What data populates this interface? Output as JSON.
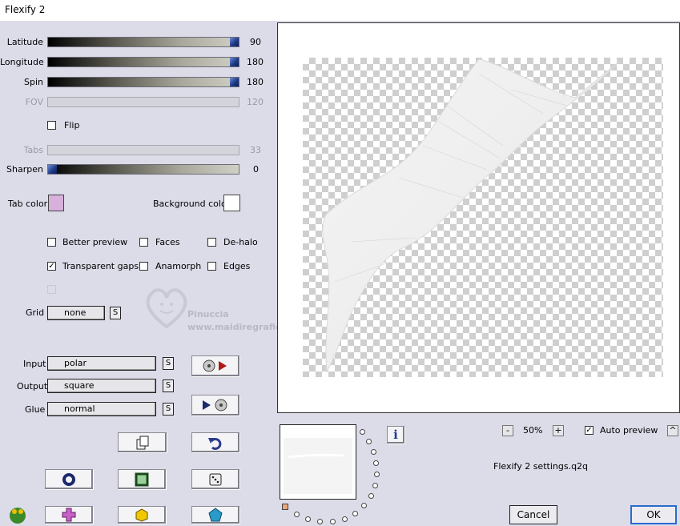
{
  "window": {
    "title": "Flexify 2"
  },
  "sliders": [
    {
      "label": "Latitude",
      "value": "90",
      "enabled": true,
      "level": 1.0
    },
    {
      "label": "Longitude",
      "value": "180",
      "enabled": true,
      "level": 1.0
    },
    {
      "label": "Spin",
      "value": "180",
      "enabled": true,
      "level": 1.0
    },
    {
      "label": "FOV",
      "value": "120",
      "enabled": false
    },
    {
      "label": "Tabs",
      "value": "33",
      "enabled": false
    },
    {
      "label": "Sharpen",
      "value": "0",
      "enabled": true,
      "level": 0.0
    }
  ],
  "flip": {
    "label": "Flip",
    "checked": false
  },
  "tab_color": {
    "label": "Tab color",
    "color": "#d8b0dc"
  },
  "background_color": {
    "label": "Background color",
    "color": "#ffffff"
  },
  "options": {
    "better_preview": {
      "label": "Better preview",
      "checked": false
    },
    "faces": {
      "label": "Faces",
      "checked": false
    },
    "de_halo": {
      "label": "De-halo",
      "checked": false
    },
    "transparent_gaps": {
      "label": "Transparent gaps",
      "checked": true
    },
    "anamorph": {
      "label": "Anamorph",
      "checked": false
    },
    "edges": {
      "label": "Edges",
      "checked": false
    }
  },
  "grid": {
    "label": "Grid",
    "value": "none",
    "s_label": "S"
  },
  "input": {
    "label": "Input",
    "value": "polar",
    "s_label": "S"
  },
  "output": {
    "label": "Output",
    "value": "square",
    "s_label": "S"
  },
  "glue": {
    "label": "Glue",
    "value": "normal",
    "s_label": "S"
  },
  "watermark": {
    "name": "Pinuccia",
    "url": "www.maidiregrafica.eu"
  },
  "zoom": {
    "minus": "-",
    "value": "50%",
    "plus": "+"
  },
  "auto_preview": {
    "label": "Auto preview",
    "checked": true
  },
  "collapse_label": "^",
  "info_label": "i",
  "settings_file": "Flexify 2 settings.q2q",
  "buttons": {
    "cancel": "Cancel",
    "ok": "OK"
  },
  "colors": {
    "accent_thumb": "#203c88",
    "background": "#dcdbe8"
  }
}
